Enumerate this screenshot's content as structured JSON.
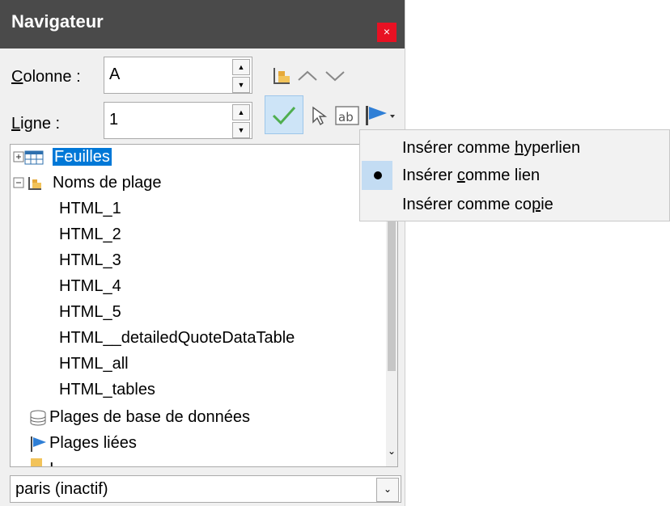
{
  "window": {
    "title": "Navigateur",
    "close_glyph": "×"
  },
  "fields": {
    "column": {
      "label_first": "C",
      "label_rest": "olonne :",
      "value": "A"
    },
    "row": {
      "label_first": "L",
      "label_rest": "igne :",
      "value": "1"
    }
  },
  "tree": {
    "sheets": "Feuilles",
    "range_names": "Noms de plage",
    "ranges": [
      "HTML_1",
      "HTML_2",
      "HTML_3",
      "HTML_4",
      "HTML_5",
      "HTML__detailedQuoteDataTable",
      "HTML_all",
      "HTML_tables"
    ],
    "db_ranges": "Plages de base de données",
    "linked_ranges": "Plages liées",
    "partial_next": "I"
  },
  "document_select": {
    "value": "paris (inactif)"
  },
  "drag_mode_menu": {
    "items": [
      {
        "pre": "Insérer comme ",
        "u": "h",
        "post": "yperlien"
      },
      {
        "pre": "Insérer ",
        "u": "c",
        "post": "omme lien"
      },
      {
        "pre": "Insérer comme co",
        "u": "p",
        "post": "ie"
      }
    ],
    "checked_index": 1
  },
  "colors": {
    "titlebar": "#4a4a4a",
    "selection": "#0078d7",
    "close": "#e81123",
    "menu_highlight": "#c3dcf3"
  }
}
